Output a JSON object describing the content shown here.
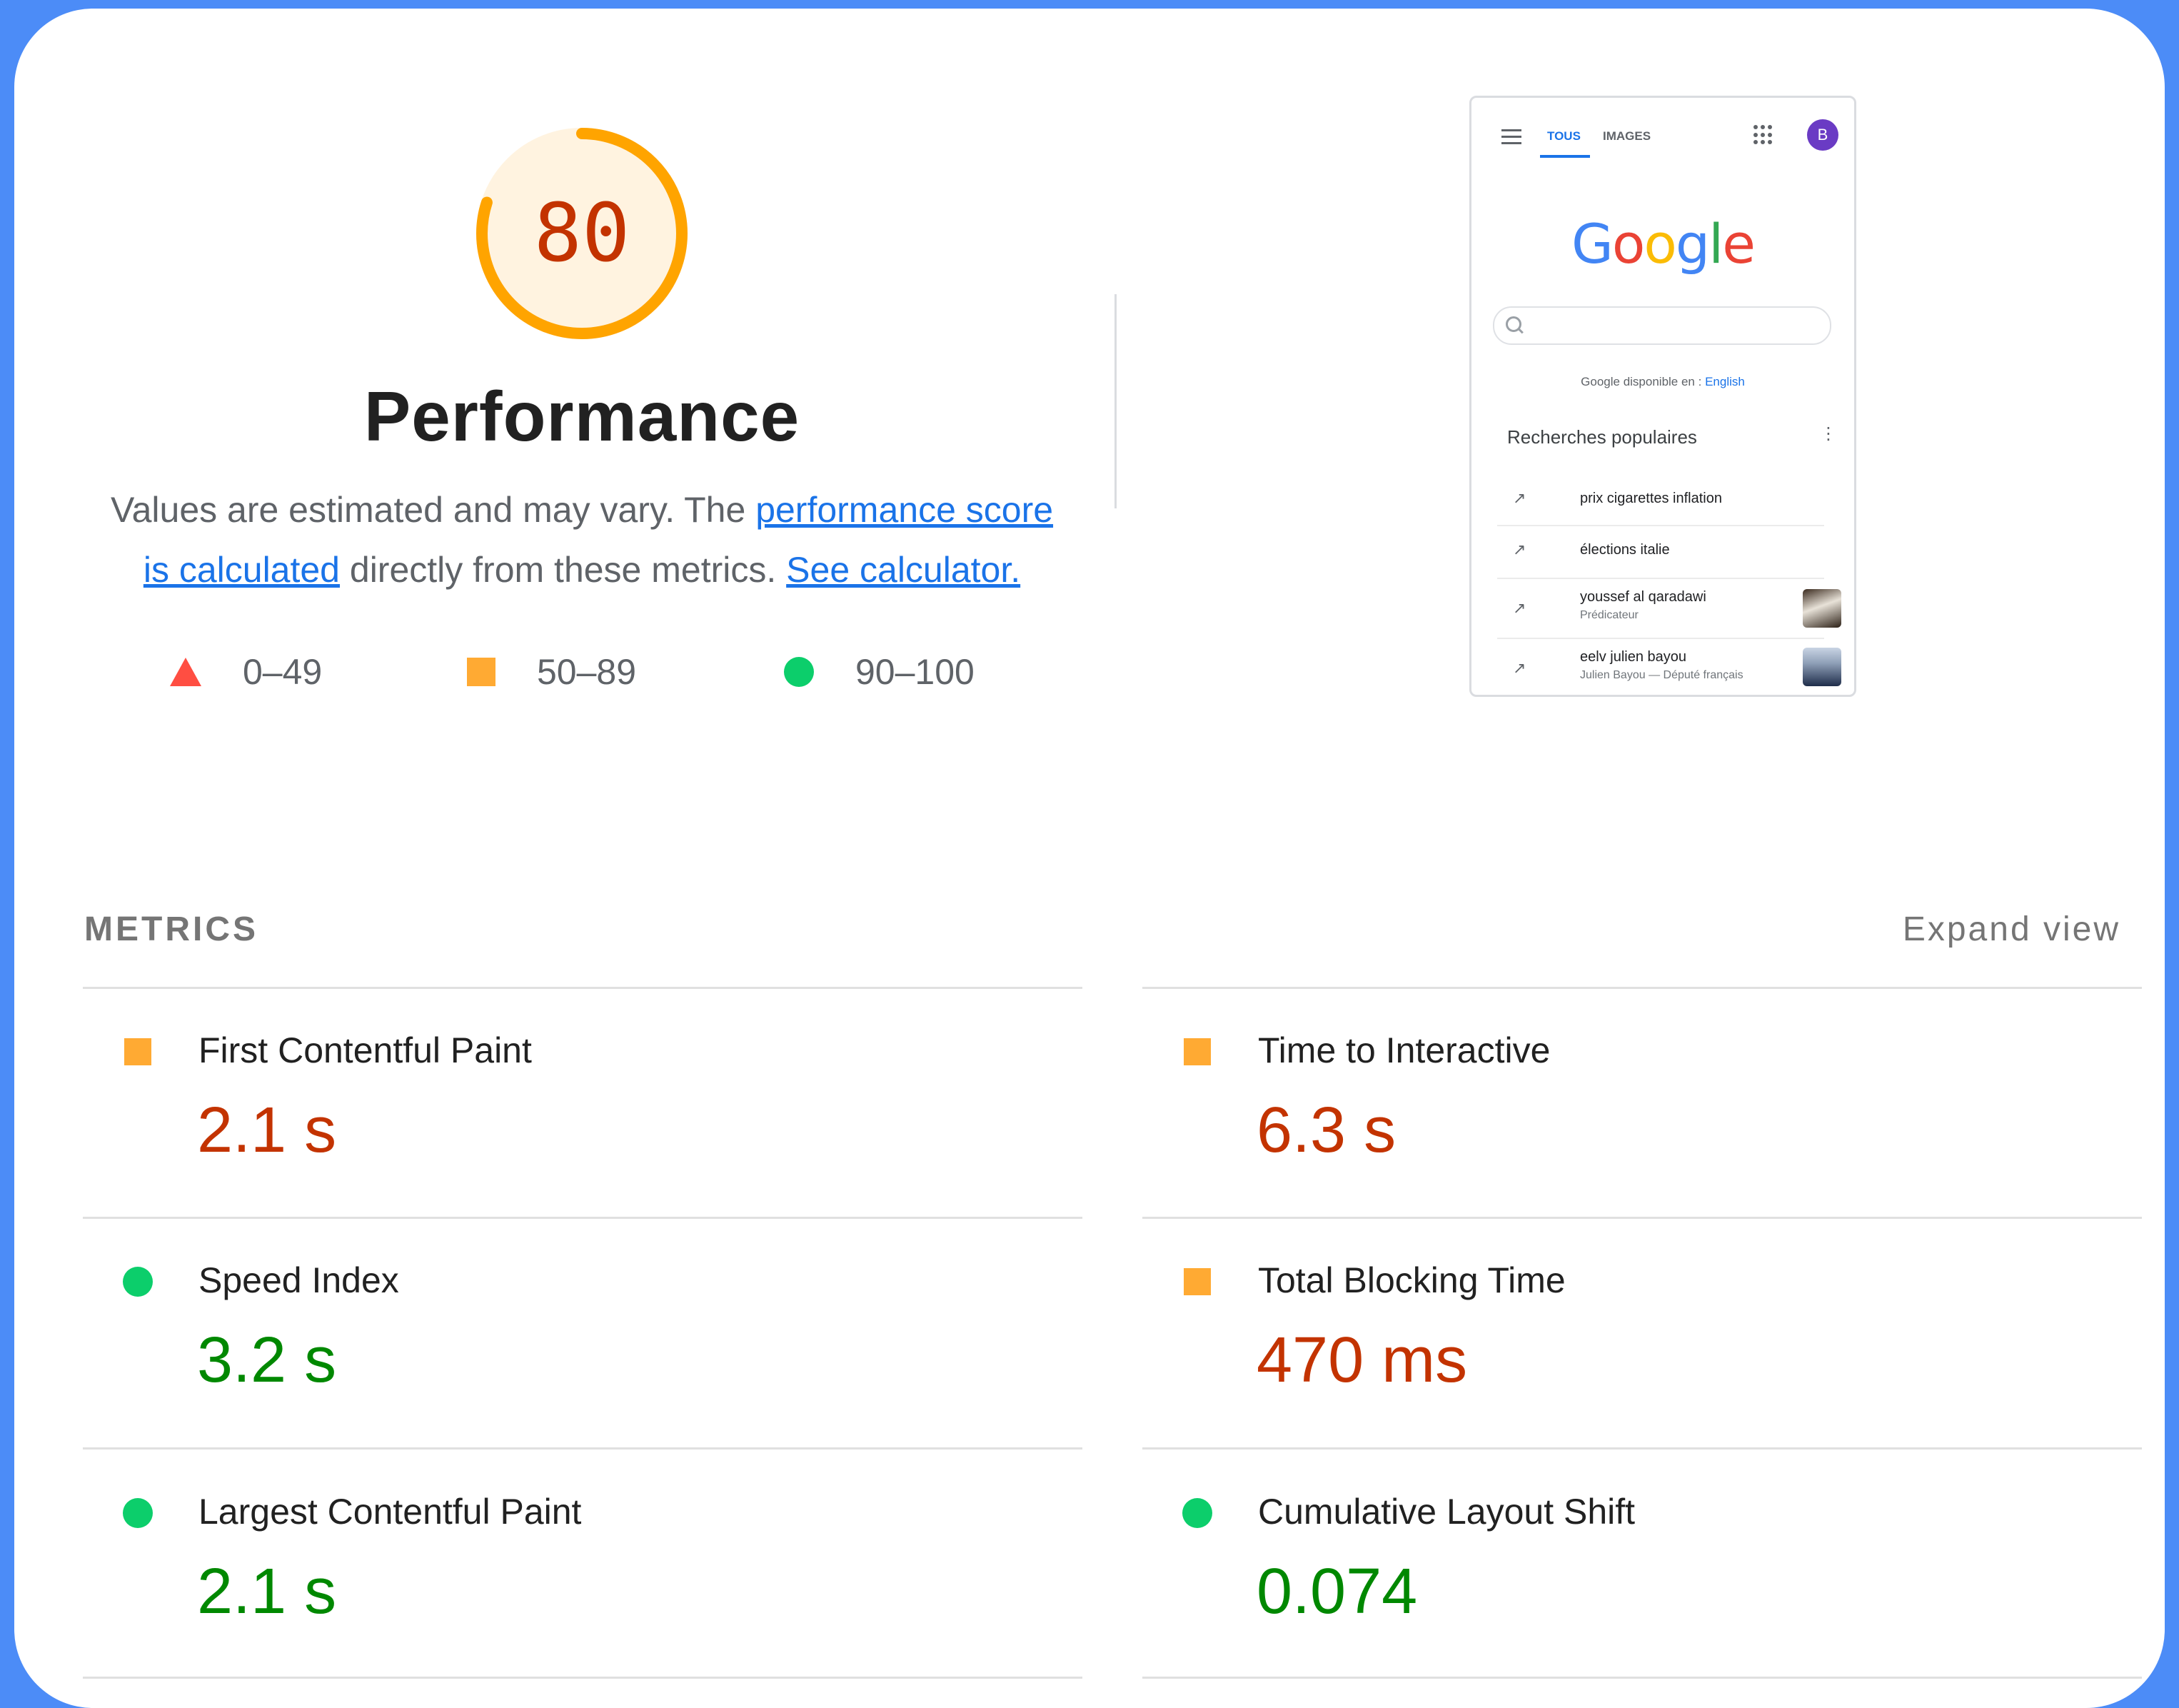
{
  "gauge": {
    "score": "80",
    "fraction": 0.8,
    "color": "#ffa400"
  },
  "title": "Performance",
  "description": {
    "text1": "Values are estimated and may vary. The ",
    "link1": "performance score is calculated",
    "text2": " directly from these metrics. ",
    "link2": "See calculator."
  },
  "legend": [
    {
      "shape": "triangle",
      "range": "0–49",
      "color": "#ff4e42"
    },
    {
      "shape": "square",
      "range": "50–89",
      "color": "#ffaa33"
    },
    {
      "shape": "circle",
      "range": "90–100",
      "color": "#0cce6b"
    }
  ],
  "screenshot": {
    "tabs": [
      "TOUS",
      "IMAGES"
    ],
    "avatar": "B",
    "logo": "Google",
    "available": "Google disponible en :",
    "available_lang": "English",
    "popular_title": "Recherches populaires",
    "more": "⋮",
    "trend_icon": "↗",
    "items": [
      {
        "query": "prix cigarettes inflation",
        "sub": ""
      },
      {
        "query": "élections italie",
        "sub": ""
      },
      {
        "query": "youssef al qaradawi",
        "sub": "Prédicateur"
      },
      {
        "query": "eelv julien bayou",
        "sub": "Julien Bayou — Député français"
      }
    ]
  },
  "metrics_header": "METRICS",
  "expand_view": "Expand view",
  "metrics": [
    {
      "label": "First Contentful Paint",
      "value": "2.1 s",
      "status": "average"
    },
    {
      "label": "Time to Interactive",
      "value": "6.3 s",
      "status": "average"
    },
    {
      "label": "Speed Index",
      "value": "3.2 s",
      "status": "pass"
    },
    {
      "label": "Total Blocking Time",
      "value": "470 ms",
      "status": "average"
    },
    {
      "label": "Largest Contentful Paint",
      "value": "2.1 s",
      "status": "pass"
    },
    {
      "label": "Cumulative Layout Shift",
      "value": "0.074",
      "status": "pass"
    }
  ]
}
